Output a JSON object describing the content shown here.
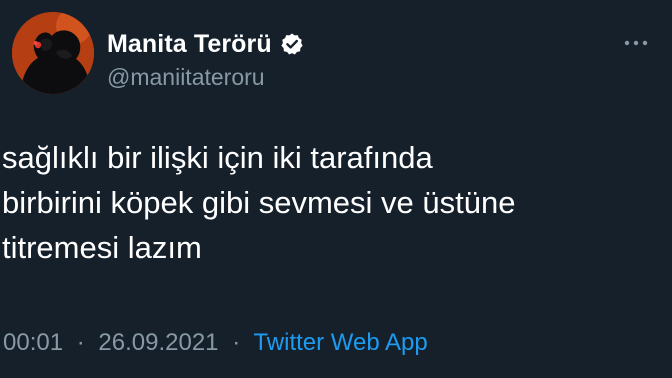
{
  "tweet": {
    "author": {
      "display_name": "Manita Terörü",
      "handle": "@maniitateroru",
      "verified": true
    },
    "text": "sağlıklı bir ilişki için iki tarafında\nbirbirini köpek gibi sevmesi ve üstüne\ntitremesi lazım",
    "time": "00:01",
    "separator": "·",
    "date": "26.09.2021",
    "source": "Twitter Web App"
  },
  "colors": {
    "background": "#15202b",
    "text_primary": "#ffffff",
    "text_secondary": "#8899a6",
    "link": "#1d9bf0",
    "verified_badge": "#ffffff",
    "avatar_background": "#b53e12"
  },
  "icons": {
    "avatar": "avatar-image",
    "verified": "verified-badge-icon",
    "more": "more-options-icon"
  }
}
